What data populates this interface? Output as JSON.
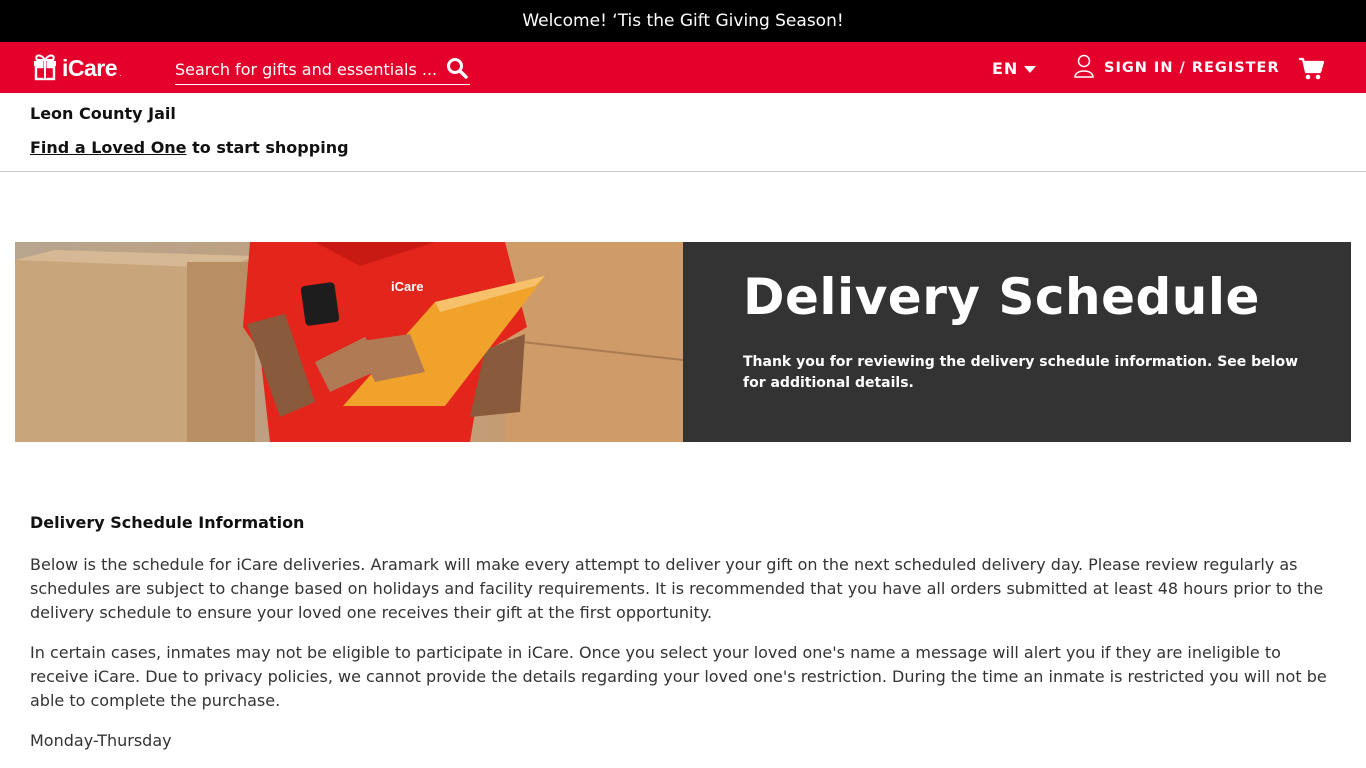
{
  "announcement": "Welcome! ‘Tis the Gift Giving Season!",
  "header": {
    "brand": "iCare",
    "brand_mark": ".",
    "search_placeholder": "Search for gifts and essentials ...",
    "language": "EN",
    "signin_label": "SIGN IN / REGISTER",
    "logo_image_text": "iCare",
    "colors": {
      "brand_red": "#e4002b",
      "announce_bg": "#000000",
      "hero_panel_bg": "#333333"
    }
  },
  "facility": {
    "name": "Leon County Jail",
    "find_link": "Find a Loved One",
    "find_suffix": " to start shopping"
  },
  "hero": {
    "title": "Delivery Schedule",
    "subtitle": "Thank you for reviewing the delivery schedule information. See below for additional details."
  },
  "content": {
    "heading": "Delivery Schedule Information",
    "paragraph1": "Below is the schedule for iCare deliveries. Aramark will make every attempt to deliver your gift on the next scheduled delivery day. Please review regularly as schedules are subject to change based on holidays and facility requirements. It is recommended that you have all orders submitted at least 48 hours prior to the delivery schedule to ensure your loved one receives their gift at the first opportunity.",
    "paragraph2": "In certain cases, inmates may not be eligible to participate in iCare. Once you select your loved one's name a message will alert you if they are ineligible to receive iCare. Due to privacy policies, we cannot provide the details regarding your loved one's restriction. During the time an inmate is restricted you will not be able to complete the purchase.",
    "schedule_days": "Monday-Thursday"
  },
  "icons": {
    "logo": "gift-box-icon",
    "search": "search-icon",
    "language_caret": "caret-down-icon",
    "user": "user-icon",
    "cart": "cart-icon"
  }
}
